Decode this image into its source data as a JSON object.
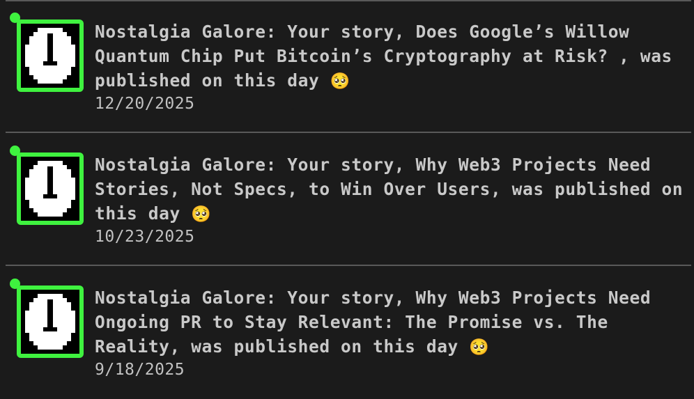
{
  "colors": {
    "background": "#1b1b1b",
    "divider": "#5a5a5a",
    "unread": "#3ff23f",
    "avatar_accent": "#3ff23f",
    "text": "#c9c9c9"
  },
  "notifications": [
    {
      "message": "Nostalgia Galore: Your story, Does Google’s Willow Quantum Chip Put Bitcoin’s Cryptography at Risk? , was published on this day",
      "emoji": "🥺",
      "date": "12/20/2025",
      "unread": true,
      "icon": "clock-icon"
    },
    {
      "message": "Nostalgia Galore: Your story, Why Web3 Projects Need Stories, Not Specs, to Win Over Users, was published on this day",
      "emoji": "🥺",
      "date": "10/23/2025",
      "unread": true,
      "icon": "clock-icon"
    },
    {
      "message": "Nostalgia Galore: Your story, Why Web3 Projects Need Ongoing PR to Stay Relevant: The Promise vs. The Reality, was published on this day",
      "emoji": "🥺",
      "date": "9/18/2025",
      "unread": true,
      "icon": "clock-icon"
    }
  ]
}
